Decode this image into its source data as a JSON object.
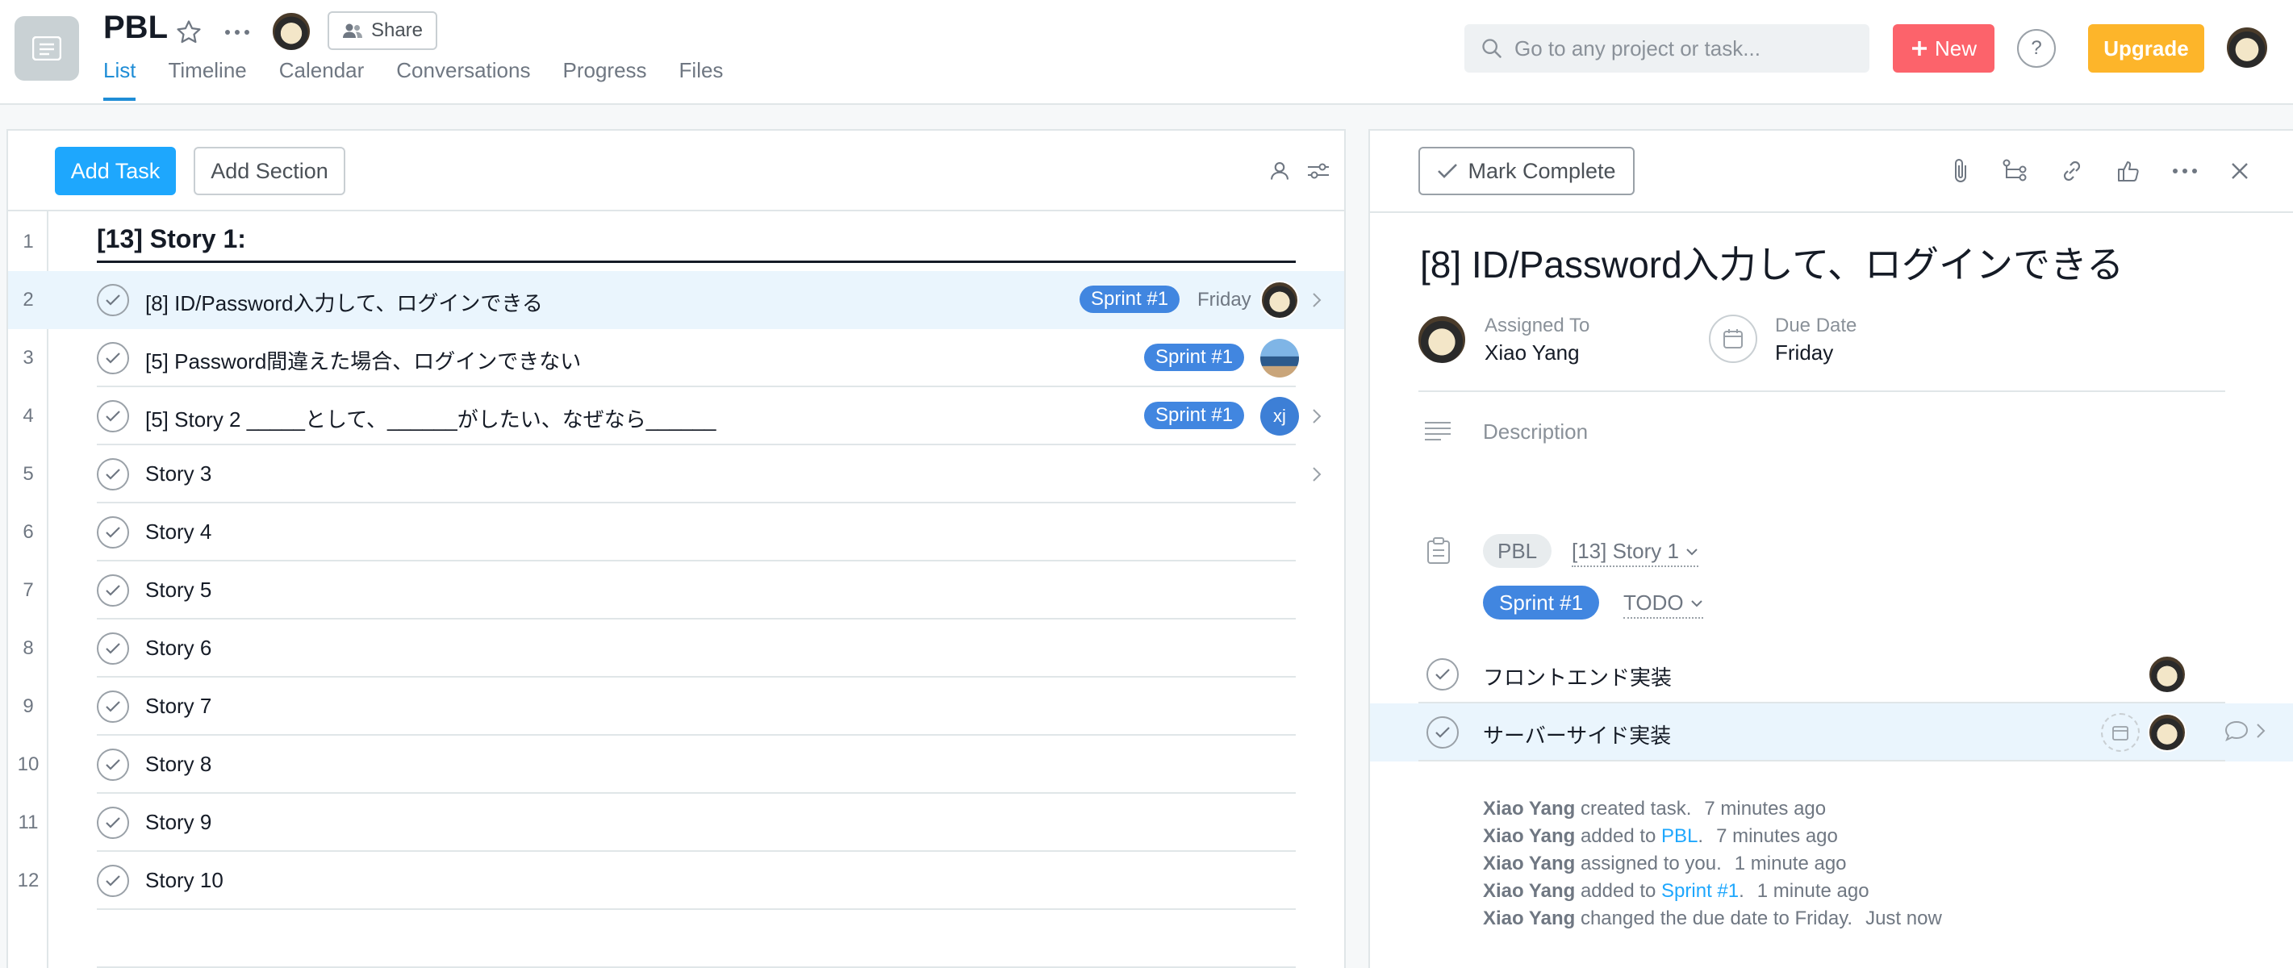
{
  "project": {
    "title": "PBL",
    "share_label": "Share"
  },
  "tabs": [
    "List",
    "Timeline",
    "Calendar",
    "Conversations",
    "Progress",
    "Files"
  ],
  "active_tab": "List",
  "search": {
    "placeholder": "Go to any project or task..."
  },
  "header_buttons": {
    "new_label": "New",
    "help_label": "?",
    "upgrade_label": "Upgrade"
  },
  "list_toolbar": {
    "add_task": "Add Task",
    "add_section": "Add Section"
  },
  "list": {
    "rows": [
      {
        "num": "1",
        "type": "section",
        "name": "[13] Story 1:"
      },
      {
        "num": "2",
        "type": "task",
        "name": "[8] ID/Password入力して、ログインできる",
        "tag": "Sprint #1",
        "due": "Friday",
        "assignee": "avatar",
        "selected": true,
        "chevron": true
      },
      {
        "num": "3",
        "type": "task",
        "name": "[5] Password間違えた場合、ログインできない",
        "tag": "Sprint #1",
        "assignee": "photo"
      },
      {
        "num": "4",
        "type": "task",
        "name": "[5] Story 2 _____として、______がしたい、なぜなら______",
        "tag": "Sprint #1",
        "assignee": "xj",
        "assignee_initials": "xj",
        "chevron": true
      },
      {
        "num": "5",
        "type": "task",
        "name": "Story 3",
        "chevron": true
      },
      {
        "num": "6",
        "type": "task",
        "name": "Story 4"
      },
      {
        "num": "7",
        "type": "task",
        "name": "Story 5"
      },
      {
        "num": "8",
        "type": "task",
        "name": "Story 6"
      },
      {
        "num": "9",
        "type": "task",
        "name": "Story 7"
      },
      {
        "num": "10",
        "type": "task",
        "name": "Story 8"
      },
      {
        "num": "11",
        "type": "task",
        "name": "Story 9"
      },
      {
        "num": "12",
        "type": "task",
        "name": "Story 10"
      }
    ]
  },
  "detail": {
    "mark_complete": "Mark Complete",
    "title": "[8] ID/Password入力して、ログインできる",
    "assigned_label": "Assigned To",
    "assigned_value": "Xiao Yang",
    "due_label": "Due Date",
    "due_value": "Friday",
    "description_placeholder": "Description",
    "project_pill": "PBL",
    "section_select": "[13] Story 1",
    "sprint_tag": "Sprint #1",
    "status_select": "TODO",
    "subtasks": [
      {
        "name": "フロントエンド実装"
      },
      {
        "name": "サーバーサイド実装"
      }
    ],
    "activity": [
      {
        "who": "Xiao Yang",
        "text": "created task.",
        "link": "",
        "tail": "",
        "time": "7 minutes ago"
      },
      {
        "who": "Xiao Yang",
        "text": "added to",
        "link": "PBL",
        "tail": ".",
        "time": "7 minutes ago"
      },
      {
        "who": "Xiao Yang",
        "text": "assigned to you.",
        "link": "",
        "tail": "",
        "time": "1 minute ago"
      },
      {
        "who": "Xiao Yang",
        "text": "added to",
        "link": "Sprint #1",
        "tail": ".",
        "time": "1 minute ago"
      },
      {
        "who": "Xiao Yang",
        "text": "changed the due date to Friday.",
        "link": "",
        "tail": "",
        "time": "Just now"
      }
    ]
  },
  "colors": {
    "accent_blue": "#1ea7fd",
    "tag_blue": "#4186e0",
    "new_red": "#fc636b",
    "upgrade_yellow": "#fdb52a"
  }
}
